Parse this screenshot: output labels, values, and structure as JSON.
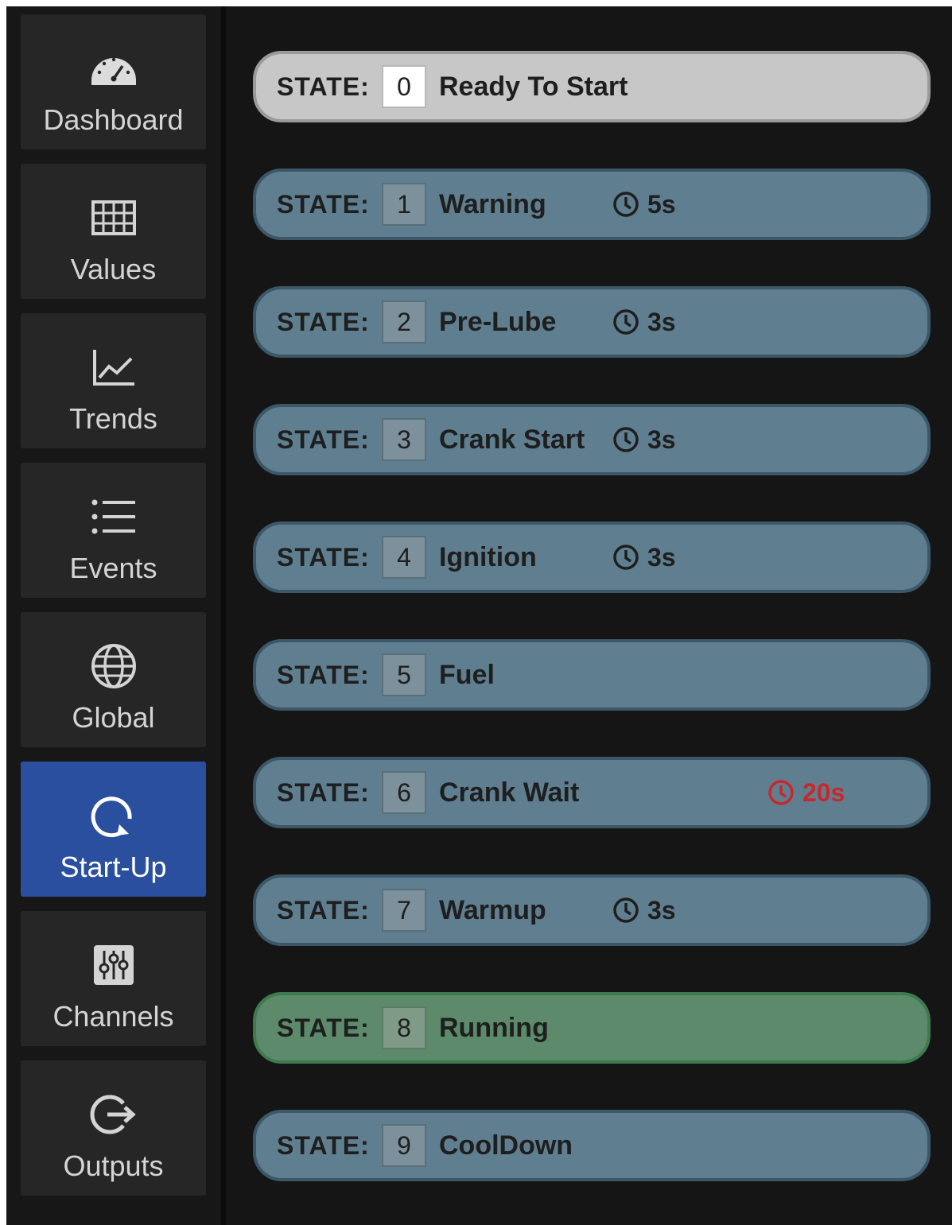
{
  "sidebar": {
    "items": [
      {
        "label": "Dashboard",
        "icon": "gauge-icon",
        "active": false
      },
      {
        "label": "Values",
        "icon": "table-grid-icon",
        "active": false
      },
      {
        "label": "Trends",
        "icon": "line-chart-icon",
        "active": false
      },
      {
        "label": "Events",
        "icon": "list-icon",
        "active": false
      },
      {
        "label": "Global",
        "icon": "globe-icon",
        "active": false
      },
      {
        "label": "Start-Up",
        "icon": "refresh-icon",
        "active": true
      },
      {
        "label": "Channels",
        "icon": "sliders-icon",
        "active": false
      },
      {
        "label": "Outputs",
        "icon": "exit-arrow-icon",
        "active": false
      }
    ]
  },
  "states": {
    "prefix": "STATE:",
    "items": [
      {
        "number": "0",
        "name": "Ready To Start",
        "timer": "",
        "style": "ready"
      },
      {
        "number": "1",
        "name": "Warning",
        "timer": "5s",
        "style": "normal"
      },
      {
        "number": "2",
        "name": "Pre-Lube",
        "timer": "3s",
        "style": "normal"
      },
      {
        "number": "3",
        "name": "Crank Start",
        "timer": "3s",
        "style": "normal"
      },
      {
        "number": "4",
        "name": "Ignition",
        "timer": "3s",
        "style": "normal"
      },
      {
        "number": "5",
        "name": "Fuel",
        "timer": "",
        "style": "normal"
      },
      {
        "number": "6",
        "name": "Crank Wait",
        "timer": "20s",
        "style": "normal",
        "timer_alert": true
      },
      {
        "number": "7",
        "name": "Warmup",
        "timer": "3s",
        "style": "normal"
      },
      {
        "number": "8",
        "name": "Running",
        "timer": "",
        "style": "running"
      },
      {
        "number": "9",
        "name": "CoolDown",
        "timer": "",
        "style": "normal"
      }
    ]
  },
  "colors": {
    "background": "#151515",
    "sidebar_item": "#262626",
    "active_item": "#2b4f9f",
    "state_default": "#5f7f90",
    "state_ready": "#c7c7c7",
    "state_running": "#5c8a6a",
    "timer_alert": "#c8282c"
  }
}
